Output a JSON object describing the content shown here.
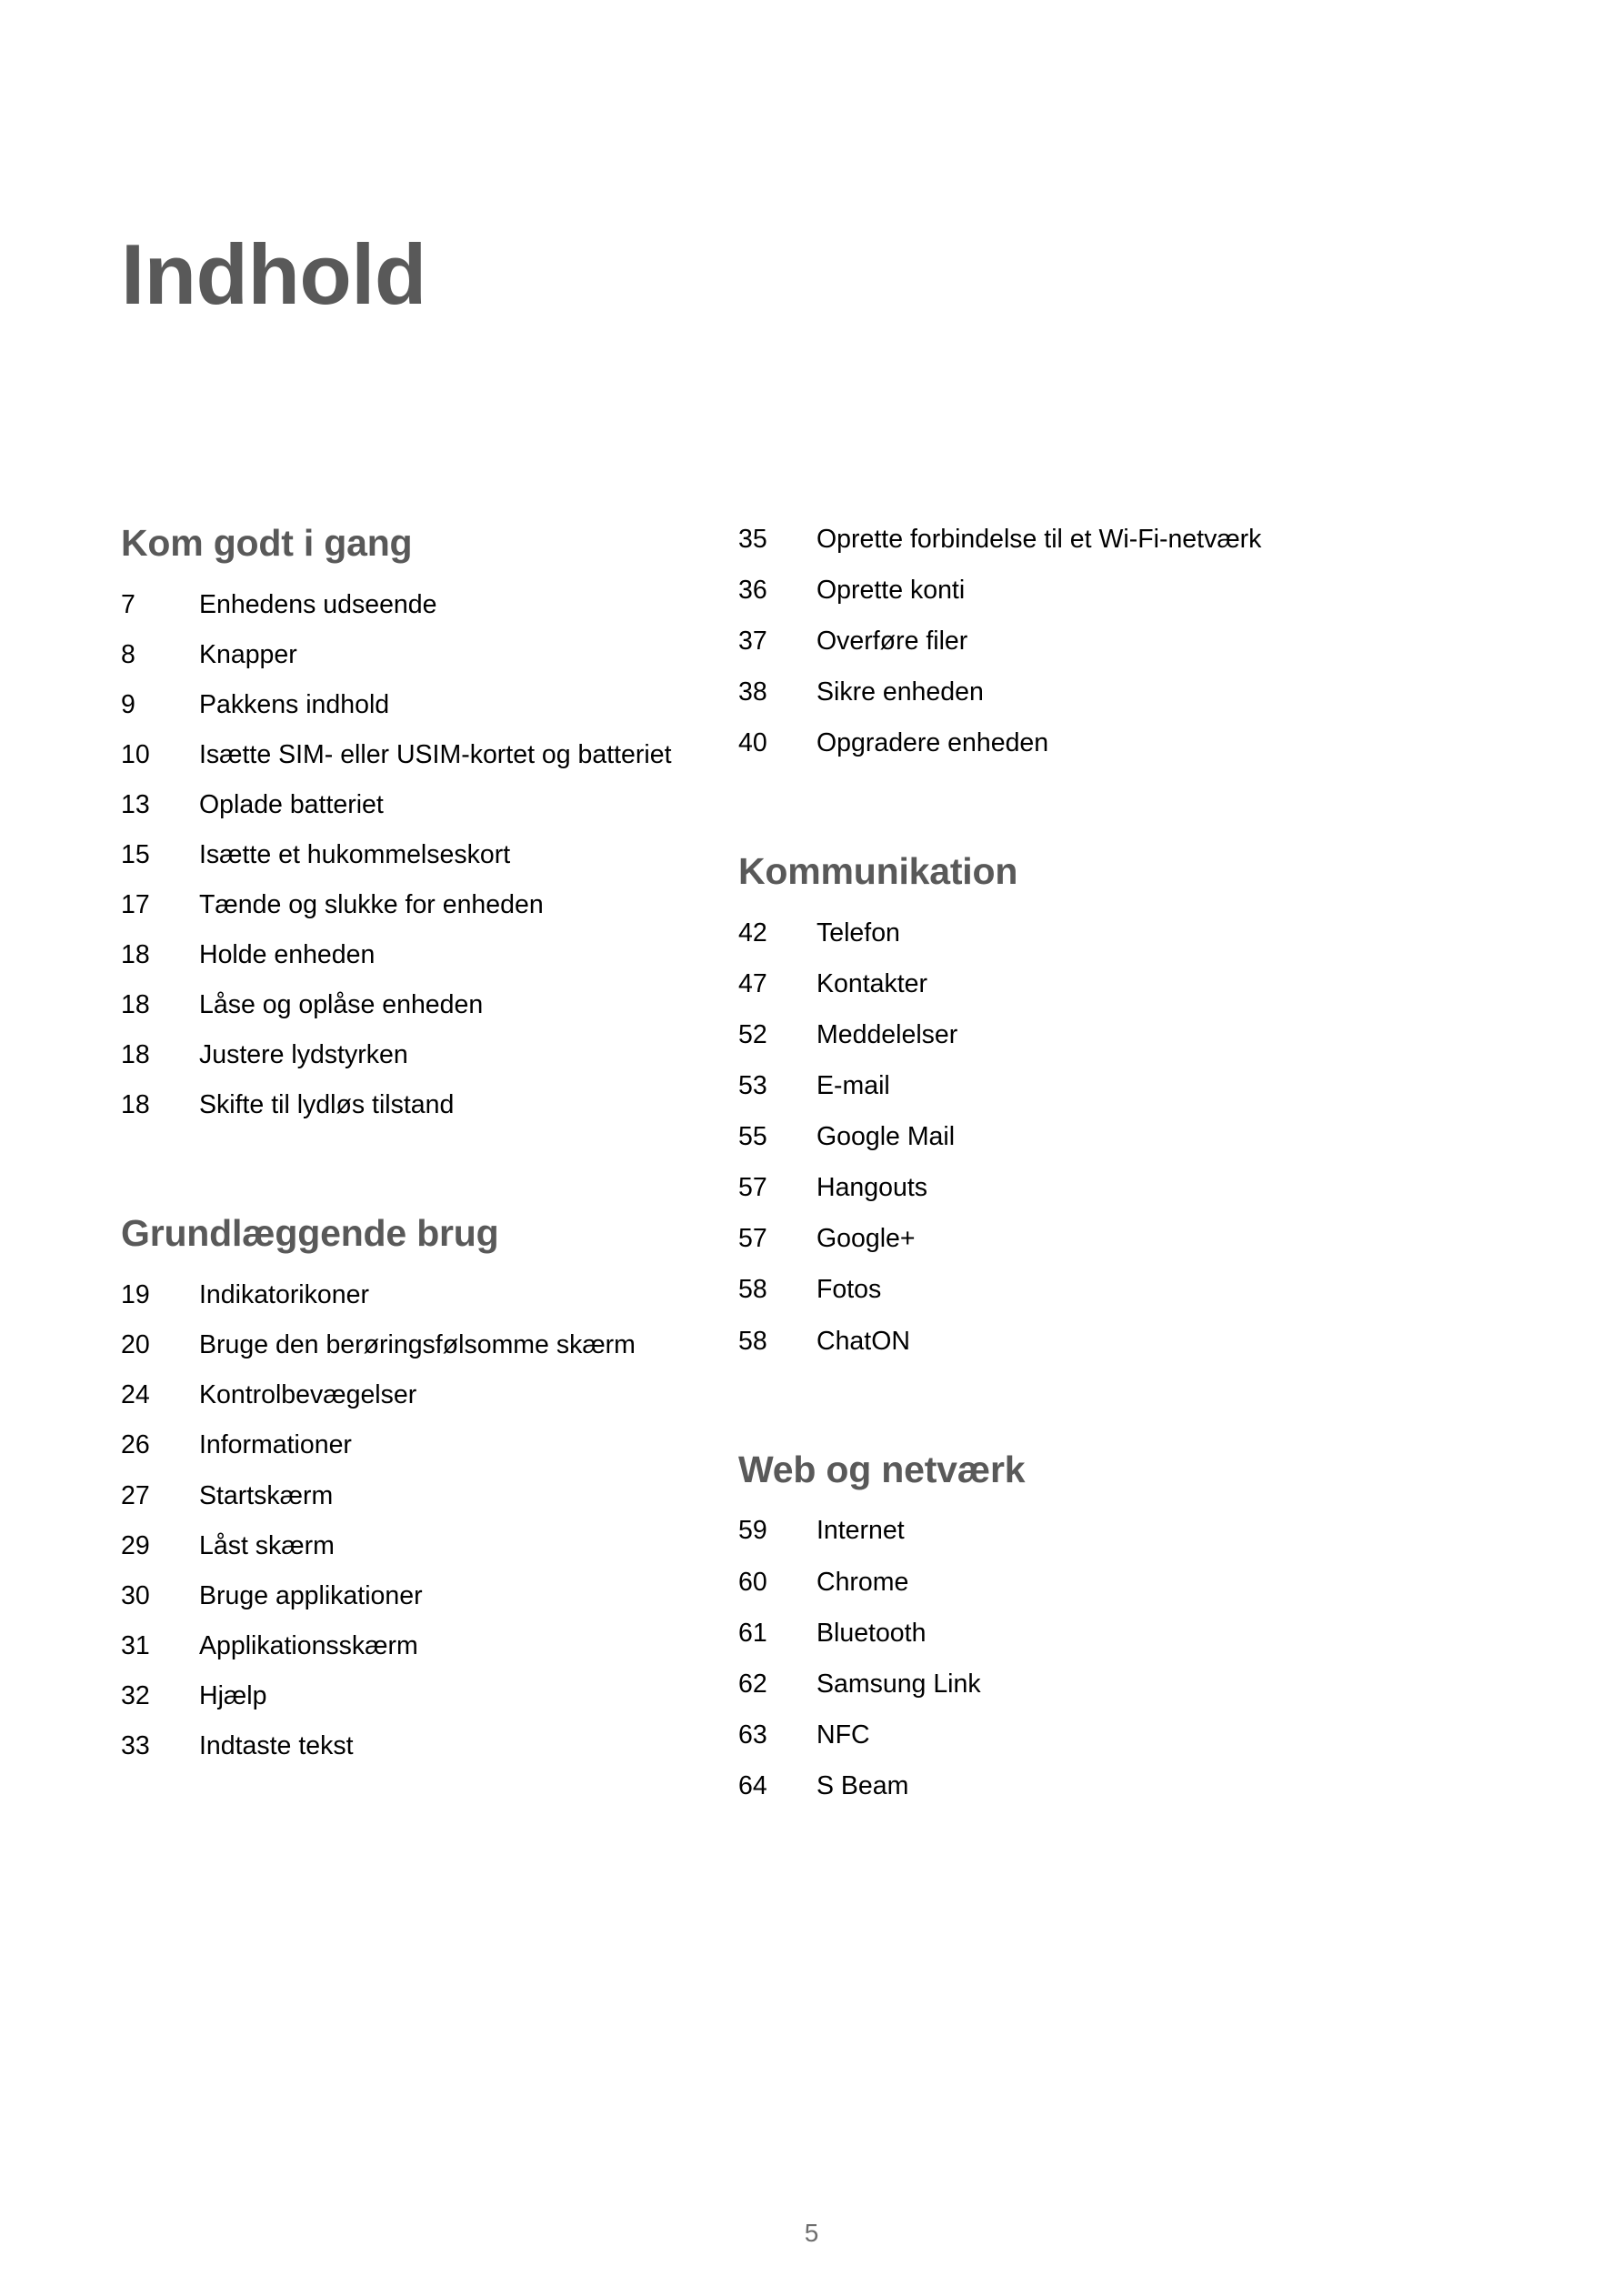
{
  "document": {
    "title": "Indhold",
    "page_number": "5",
    "heading_color": "#595959",
    "text_color": "#000000",
    "background_color": "#ffffff",
    "page_number_color": "#6e6e6e"
  },
  "columns": [
    {
      "name": "left-column",
      "sections": [
        {
          "heading": "Kom godt i gang",
          "entries": [
            {
              "page": "7",
              "title": "Enhedens udseende"
            },
            {
              "page": "8",
              "title": "Knapper"
            },
            {
              "page": "9",
              "title": "Pakkens indhold"
            },
            {
              "page": "10",
              "title": "Isætte SIM- eller USIM-kortet og batteriet"
            },
            {
              "page": "13",
              "title": "Oplade batteriet"
            },
            {
              "page": "15",
              "title": "Isætte et hukommelseskort"
            },
            {
              "page": "17",
              "title": "Tænde og slukke for enheden"
            },
            {
              "page": "18",
              "title": "Holde enheden"
            },
            {
              "page": "18",
              "title": "Låse og oplåse enheden"
            },
            {
              "page": "18",
              "title": "Justere lydstyrken"
            },
            {
              "page": "18",
              "title": "Skifte til lydløs tilstand"
            }
          ]
        },
        {
          "heading": "Grundlæggende brug",
          "entries": [
            {
              "page": "19",
              "title": "Indikatorikoner"
            },
            {
              "page": "20",
              "title": "Bruge den berøringsfølsomme skærm"
            },
            {
              "page": "24",
              "title": "Kontrolbevægelser"
            },
            {
              "page": "26",
              "title": "Informationer"
            },
            {
              "page": "27",
              "title": "Startskærm"
            },
            {
              "page": "29",
              "title": "Låst skærm"
            },
            {
              "page": "30",
              "title": "Bruge applikationer"
            },
            {
              "page": "31",
              "title": "Applikationsskærm"
            },
            {
              "page": "32",
              "title": "Hjælp"
            },
            {
              "page": "33",
              "title": "Indtaste tekst"
            }
          ]
        }
      ]
    },
    {
      "name": "right-column",
      "sections": [
        {
          "heading": "",
          "heading_hidden": true,
          "entries": [
            {
              "page": "35",
              "title": "Oprette forbindelse til et Wi-Fi-netværk"
            },
            {
              "page": "36",
              "title": "Oprette konti"
            },
            {
              "page": "37",
              "title": "Overføre filer"
            },
            {
              "page": "38",
              "title": "Sikre enheden"
            },
            {
              "page": "40",
              "title": "Opgradere enheden"
            }
          ]
        },
        {
          "heading": "Kommunikation",
          "entries": [
            {
              "page": "42",
              "title": "Telefon"
            },
            {
              "page": "47",
              "title": "Kontakter"
            },
            {
              "page": "52",
              "title": "Meddelelser"
            },
            {
              "page": "53",
              "title": "E-mail"
            },
            {
              "page": "55",
              "title": "Google Mail"
            },
            {
              "page": "57",
              "title": "Hangouts"
            },
            {
              "page": "57",
              "title": "Google+"
            },
            {
              "page": "58",
              "title": "Fotos"
            },
            {
              "page": "58",
              "title": "ChatON"
            }
          ]
        },
        {
          "heading": "Web og netværk",
          "entries": [
            {
              "page": "59",
              "title": "Internet"
            },
            {
              "page": "60",
              "title": "Chrome"
            },
            {
              "page": "61",
              "title": "Bluetooth"
            },
            {
              "page": "62",
              "title": "Samsung Link"
            },
            {
              "page": "63",
              "title": "NFC"
            },
            {
              "page": "64",
              "title": "S Beam"
            }
          ]
        }
      ]
    }
  ]
}
